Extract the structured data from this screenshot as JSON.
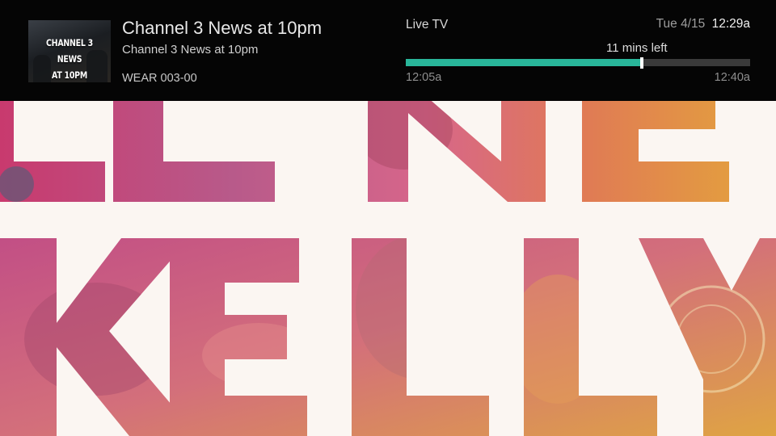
{
  "program": {
    "thumbnail_text_line1": "CHANNEL 3 NEWS",
    "thumbnail_text_line2": "AT 10PM",
    "title": "Channel 3 News at 10pm",
    "subtitle": "Channel 3 News at 10pm",
    "channel": "WEAR 003-00"
  },
  "status": {
    "mode": "Live TV",
    "date": "Tue 4/15",
    "time": "12:29a",
    "remaining": "11 mins left",
    "start_time": "12:05a",
    "end_time": "12:40a",
    "progress_fraction": 0.686
  },
  "background": {
    "show_text_row1": "LLNE",
    "show_text_row2": "KELLY"
  },
  "colors": {
    "overlay_bg": "#050505",
    "progress_fill": "#29b69a",
    "progress_track": "#3a3a3a"
  }
}
